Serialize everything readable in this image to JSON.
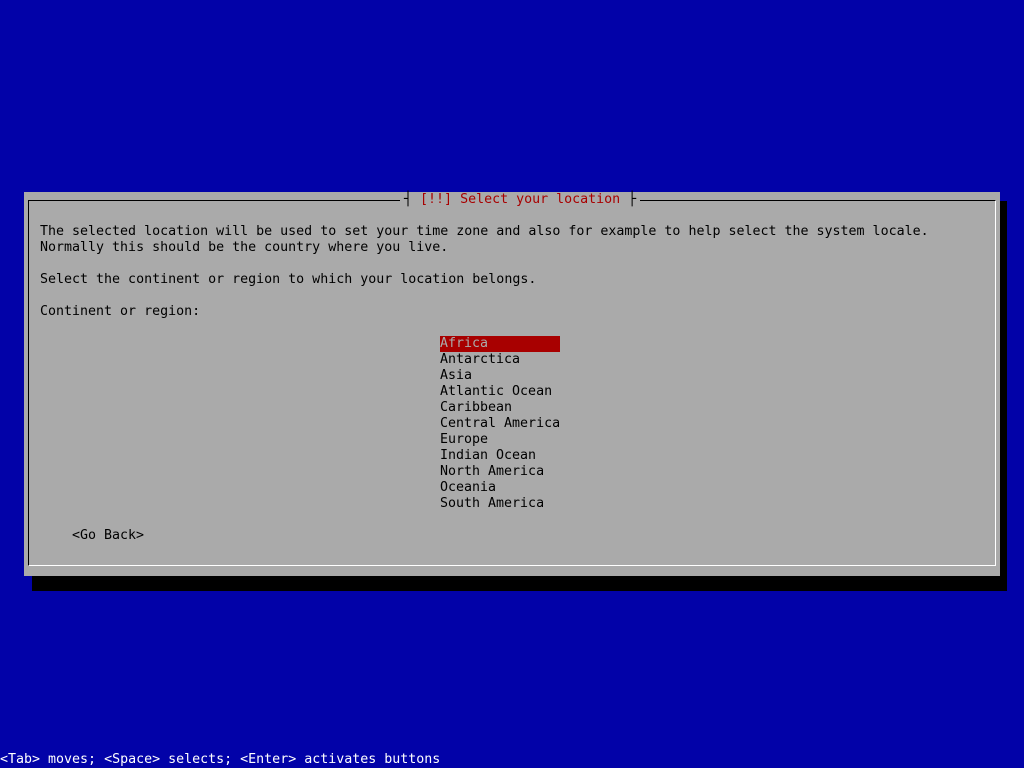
{
  "dialog": {
    "title_marker": "[!!]",
    "title": "Select your location",
    "description_line1": "The selected location will be used to set your time zone and also for example to help select the system locale.",
    "description_line2": "Normally this should be the country where you live.",
    "instruction": "Select the continent or region to which your location belongs.",
    "list_label": "Continent or region:",
    "regions": [
      "Africa",
      "Antarctica",
      "Asia",
      "Atlantic Ocean",
      "Caribbean",
      "Central America",
      "Europe",
      "Indian Ocean",
      "North America",
      "Oceania",
      "South America"
    ],
    "selected_region": "Africa",
    "go_back_label": "<Go Back>"
  },
  "help_line": "<Tab> moves; <Space> selects; <Enter> activates buttons",
  "colors": {
    "background": "#0202a8",
    "dialog": "#aaaaaa",
    "highlight": "#a80000",
    "title_text": "#a80000"
  }
}
